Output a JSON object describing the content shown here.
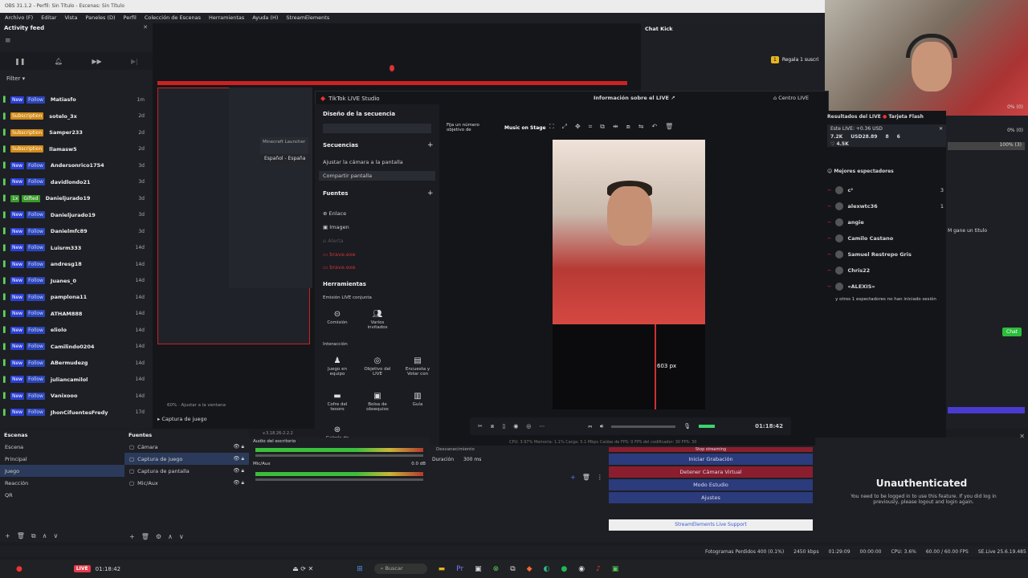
{
  "title_bar": "OBS 31.1.2 - Perfil: Sin Título - Escenas: Sin Título",
  "menu": [
    "Archivo (F)",
    "Editar",
    "Vista",
    "Paneles (D)",
    "Perfil",
    "Colección de Escenas",
    "Herramientas",
    "Ayuda (H)",
    "StreamElements"
  ],
  "activity": {
    "title": "Activity feed",
    "filter": "Filter",
    "rows": [
      {
        "badges": [
          "New",
          "Follow"
        ],
        "name": "Matiasfo",
        "time": "1m"
      },
      {
        "badges": [
          "Subscription"
        ],
        "name": "sotelo_3x",
        "time": "2d"
      },
      {
        "badges": [
          "Subscription"
        ],
        "name": "Samper233",
        "time": "2d"
      },
      {
        "badges": [
          "Subscription"
        ],
        "name": "llamasw5",
        "time": "2d"
      },
      {
        "badges": [
          "New",
          "Follow"
        ],
        "name": "Andersonrico1754",
        "time": "3d"
      },
      {
        "badges": [
          "New",
          "Follow"
        ],
        "name": "davidlondo21",
        "time": "3d"
      },
      {
        "badges": [
          "1x",
          "Gifted"
        ],
        "name": "Danieljurado19",
        "time": "3d"
      },
      {
        "badges": [
          "New",
          "Follow"
        ],
        "name": "Danieljurado19",
        "time": "3d"
      },
      {
        "badges": [
          "New",
          "Follow"
        ],
        "name": "Danielmfc89",
        "time": "3d"
      },
      {
        "badges": [
          "New",
          "Follow"
        ],
        "name": "Luisrm333",
        "time": "14d"
      },
      {
        "badges": [
          "New",
          "Follow"
        ],
        "name": "andresg18",
        "time": "14d"
      },
      {
        "badges": [
          "New",
          "Follow"
        ],
        "name": "Juanes_0",
        "time": "14d"
      },
      {
        "badges": [
          "New",
          "Follow"
        ],
        "name": "pamplona11",
        "time": "14d"
      },
      {
        "badges": [
          "New",
          "Follow"
        ],
        "name": "ATHAM888",
        "time": "14d"
      },
      {
        "badges": [
          "New",
          "Follow"
        ],
        "name": "eliolo",
        "time": "14d"
      },
      {
        "badges": [
          "New",
          "Follow"
        ],
        "name": "Camilindo0204",
        "time": "14d"
      },
      {
        "badges": [
          "New",
          "Follow"
        ],
        "name": "ABermudezg",
        "time": "14d"
      },
      {
        "badges": [
          "New",
          "Follow"
        ],
        "name": "juliancamilol",
        "time": "14d"
      },
      {
        "badges": [
          "New",
          "Follow"
        ],
        "name": "Vanixooo",
        "time": "14d"
      },
      {
        "badges": [
          "New",
          "Follow"
        ],
        "name": "JhonCifuentesFredy",
        "time": "17d"
      }
    ]
  },
  "chat_kick": {
    "title": "Chat Kick",
    "notice": "Regala 1 suscri"
  },
  "tiktok": {
    "app_title": "TikTok LIVE Studio",
    "live_info": "Información sobre el LIVE",
    "center": "Centro LIVE",
    "diseno": "Diseño de la secuencia",
    "secuencias": "Secuencias",
    "seq_items": [
      "Ajustar la cámara a la pantalla",
      "Compartir pantalla"
    ],
    "fuentes": "Fuentes",
    "source_items": [
      "Enlace",
      "Imagen",
      "Alerta",
      "brave.exe",
      "brave.exe"
    ],
    "herramientas": "Herramientas",
    "emision": "Emisión LIVE conjunta",
    "tools": [
      "Comisión",
      "Varios invitados"
    ],
    "interaccion": "Interacción",
    "interactions": [
      "Juego en equipo",
      "Objetivo del LIVE",
      "Encuesta y Votar con",
      "Cofre del tesoro",
      "Bolsa de obsequios",
      "Guía"
    ],
    "gallery": "Galería de",
    "music": "Music on Stage",
    "goal_text": "Fija un número objetivo de",
    "measure": "603 px",
    "time": "01:18:42",
    "lang": "Español - España",
    "minecraft": "Minecraft Launcher",
    "stats": "CPU: 3.97%   Memoria: 1.1%   Carga: 5.1 Mbps   Caídas de FPS: 0   FPS del codificador: 30   FPS: 30"
  },
  "results": {
    "title": "Resultados del LIVE",
    "flash": "Tarjeta Flash",
    "earnings": "Este LIVE: +0.36 USD",
    "metrics": [
      "7.2K",
      "USD28.89",
      "8",
      "6"
    ],
    "likes": "4.5K",
    "best": "Mejores espectadores",
    "viewers": [
      {
        "name": "c²",
        "n": "3"
      },
      {
        "name": "alexwtc36",
        "n": "1"
      },
      {
        "name": "angie",
        "n": ""
      },
      {
        "name": "Camilo Castano",
        "n": ""
      },
      {
        "name": "Samuel Restrepo Gris",
        "n": ""
      },
      {
        "name": "Chris22",
        "n": ""
      },
      {
        "name": "«ALEXIS»",
        "n": ""
      }
    ],
    "others": "y otros 1 espectadores no han iniciado sesión"
  },
  "right_panel": {
    "p1": "0% (0)",
    "p2": "0% (0)",
    "p3": "100% (3)",
    "title_msg": "M gane un titulo",
    "chat": "Chat"
  },
  "scenes": {
    "title": "Escenas",
    "items": [
      "Escena",
      "Principal",
      "Juego",
      "Reacción",
      "QR"
    ],
    "selected": 2
  },
  "sources": {
    "title": "Fuentes",
    "items": [
      "Cámara",
      "Captura de juego",
      "Captura de pantalla",
      "Mic/Aux"
    ]
  },
  "mixer": {
    "desktop": "Audio del escritorio",
    "mic": "Mic/Aux",
    "db": "0.0 dB",
    "version": "v.3.18.26-2.2.2"
  },
  "transitions": {
    "label": "Duración",
    "value": "300 ms",
    "fade": "Desvanecimiento"
  },
  "controls": {
    "stop": "Stop streaming",
    "virtual_start": "Iniciar Grabación",
    "virtual_stop": "Detener Cámara Virtual",
    "studio": "Modo Estudio",
    "settings": "Ajustes",
    "support": "StreamElements Live Support"
  },
  "unauth": {
    "title": "Unauthenticated",
    "text": "You need to be logged in to use this feature. If you did log in previously, please logout and login again."
  },
  "status": {
    "dropped": "Fotogramas Perdidos 400 (0.1%)",
    "kbps": "2450 kbps",
    "t1": "01:29:09",
    "t2": "00:00:00",
    "cpu": "CPU: 3.6%",
    "fps": "60.00 / 60.00 FPS",
    "se": "SE.Live 25.6.19.485"
  },
  "taskbar": {
    "live": "LIVE",
    "time": "01:18:42",
    "search": "Buscar"
  },
  "capture_label": "Captura de juego",
  "zoom": "60%",
  "fit": "Ajustar a la ventana"
}
